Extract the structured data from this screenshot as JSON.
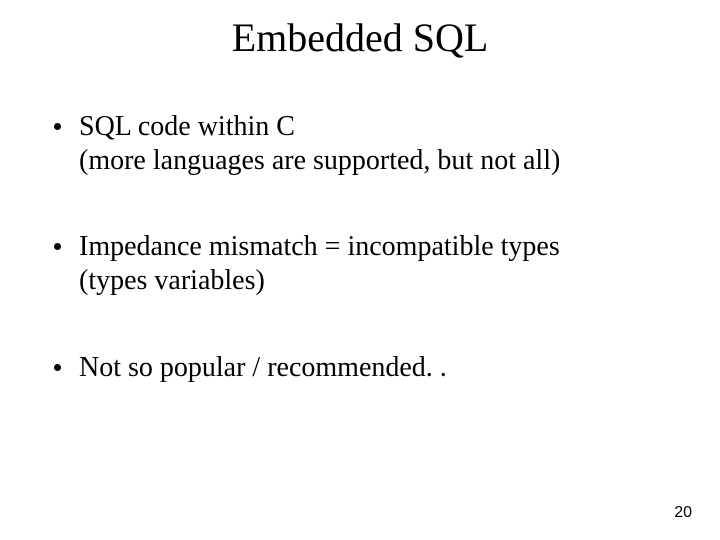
{
  "title": "Embedded SQL",
  "bullets": [
    {
      "line1": "SQL code within C",
      "line2": "(more languages are supported, but not all)"
    },
    {
      "line1": "Impedance mismatch = incompatible types",
      "line2": "(types variables)"
    },
    {
      "line1": "Not so popular / recommended. .",
      "line2": ""
    }
  ],
  "page_number": "20"
}
